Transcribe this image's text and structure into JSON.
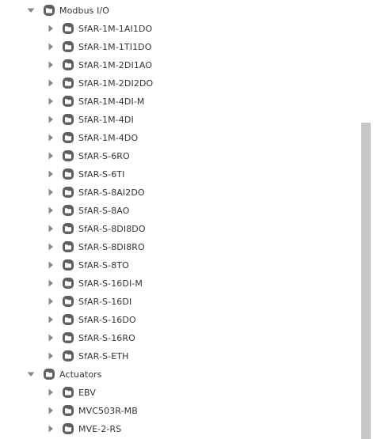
{
  "tree": {
    "modbus": {
      "label": "Modbus I/O",
      "expanded": true,
      "children": [
        "SfAR-1M-1AI1DO",
        "SfAR-1M-1TI1DO",
        "SfAR-1M-2DI1AO",
        "SfAR-1M-2DI2DO",
        "SfAR-1M-4DI-M",
        "SfAR-1M-4DI",
        "SfAR-1M-4DO",
        "SfAR-S-6RO",
        "SfAR-S-6TI",
        "SfAR-S-8AI2DO",
        "SfAR-S-8AO",
        "SfAR-S-8DI8DO",
        "SfAR-S-8DI8RO",
        "SfAR-S-8TO",
        "SfAR-S-16DI-M",
        "SfAR-S-16DI",
        "SfAR-S-16DO",
        "SfAR-S-16RO",
        "SfAR-S-ETH"
      ]
    },
    "actuators": {
      "label": "Actuators",
      "expanded": true,
      "children": [
        "EBV",
        "MVC503R-MB",
        "MVE-2-RS"
      ]
    }
  },
  "icons": {
    "expanded": "caret-down-icon",
    "collapsed": "caret-right-icon",
    "folder": "folder-icon"
  },
  "colors": {
    "text": "#333333",
    "icon": "#888888",
    "scrollbar_thumb": "#c6c6c6"
  }
}
